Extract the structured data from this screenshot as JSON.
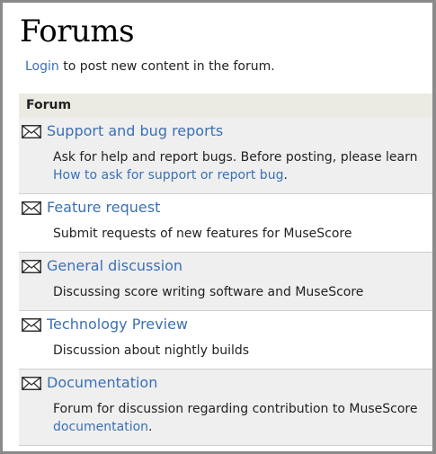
{
  "page": {
    "title": "Forums",
    "login_link": "Login",
    "login_rest": " to post new content in the forum."
  },
  "table": {
    "header": "Forum",
    "rows": [
      {
        "icon": "envelope-icon",
        "name": "Support and bug reports",
        "desc": "Ask for help and report bugs. Before posting, please learn",
        "desc_link": "How to ask for support or report bug",
        "desc_after": "."
      },
      {
        "icon": "envelope-icon",
        "name": "Feature request",
        "desc": "Submit requests of new features for MuseScore"
      },
      {
        "icon": "envelope-icon",
        "name": "General discussion",
        "desc": "Discussing score writing software and MuseScore"
      },
      {
        "icon": "envelope-icon",
        "name": "Technology Preview",
        "desc": "Discussion about nightly builds"
      },
      {
        "icon": "envelope-icon",
        "name": "Documentation",
        "desc": "Forum for discussion regarding contribution to MuseScore",
        "desc_link": "documentation",
        "desc_after": "."
      }
    ]
  },
  "colors": {
    "link": "#3b70b5",
    "header_bg": "#ecebe3",
    "row_alt_bg": "#efefef"
  }
}
